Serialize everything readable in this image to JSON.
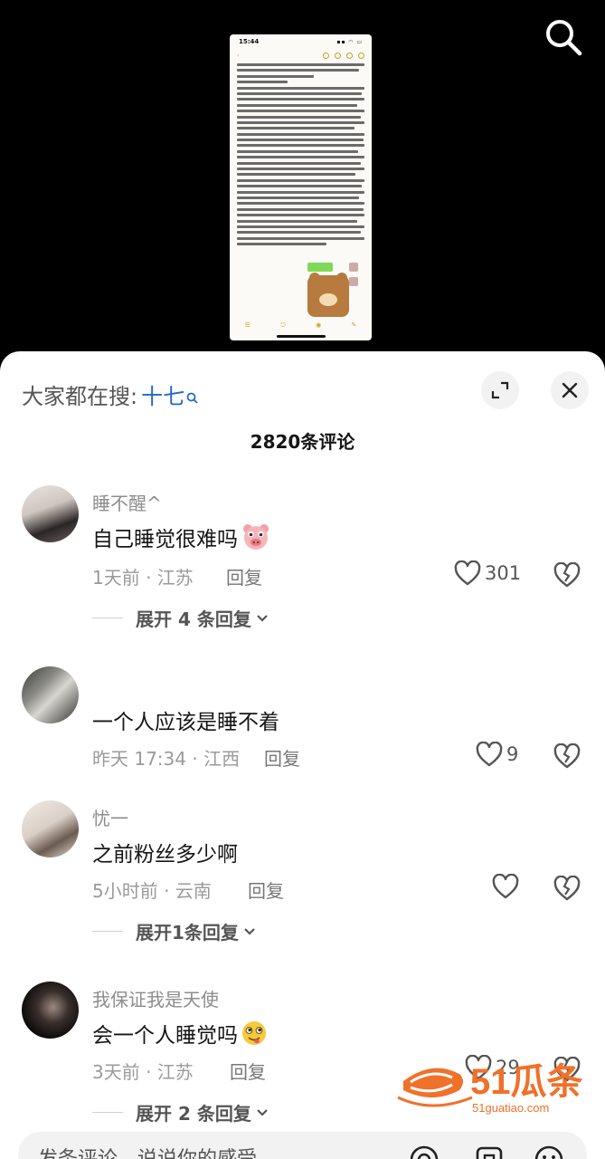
{
  "header": {
    "search_suggest_prefix": "大家都在搜:",
    "search_suggest_keyword": "十七",
    "comment_count_label": "2820条评论"
  },
  "video": {
    "phone_time": "15:44"
  },
  "comments": [
    {
      "username": "睡不醒^",
      "text": "自己睡觉很难吗",
      "emoji": "pig-face-emoji",
      "meta": "1天前 · 江苏",
      "reply_label": "回复",
      "likes": "301",
      "expand_label": "展开 4 条回复"
    },
    {
      "username": "",
      "text": "一个人应该是睡不着",
      "meta": "昨天 17:34 · 江西",
      "reply_label": "回复",
      "likes": "9"
    },
    {
      "username": "忧一",
      "text": "之前粉丝多少啊",
      "meta": "5小时前 · 云南",
      "reply_label": "回复",
      "likes": "",
      "expand_label": "展开1条回复"
    },
    {
      "username": "我保证我是天使",
      "text": "会一个人睡觉吗",
      "emoji": "drooling-face-emoji",
      "meta": "3天前 · 江苏",
      "reply_label": "回复",
      "likes": "29",
      "expand_label": "展开 2 条回复"
    }
  ],
  "input": {
    "placeholder": "发条评论，说说你的感受"
  },
  "watermark": {
    "brand": "51瓜条",
    "domain": "51guatiao.com"
  },
  "colors": {
    "accent_blue": "#2469c9",
    "watermark_orange": "#f0712a"
  }
}
